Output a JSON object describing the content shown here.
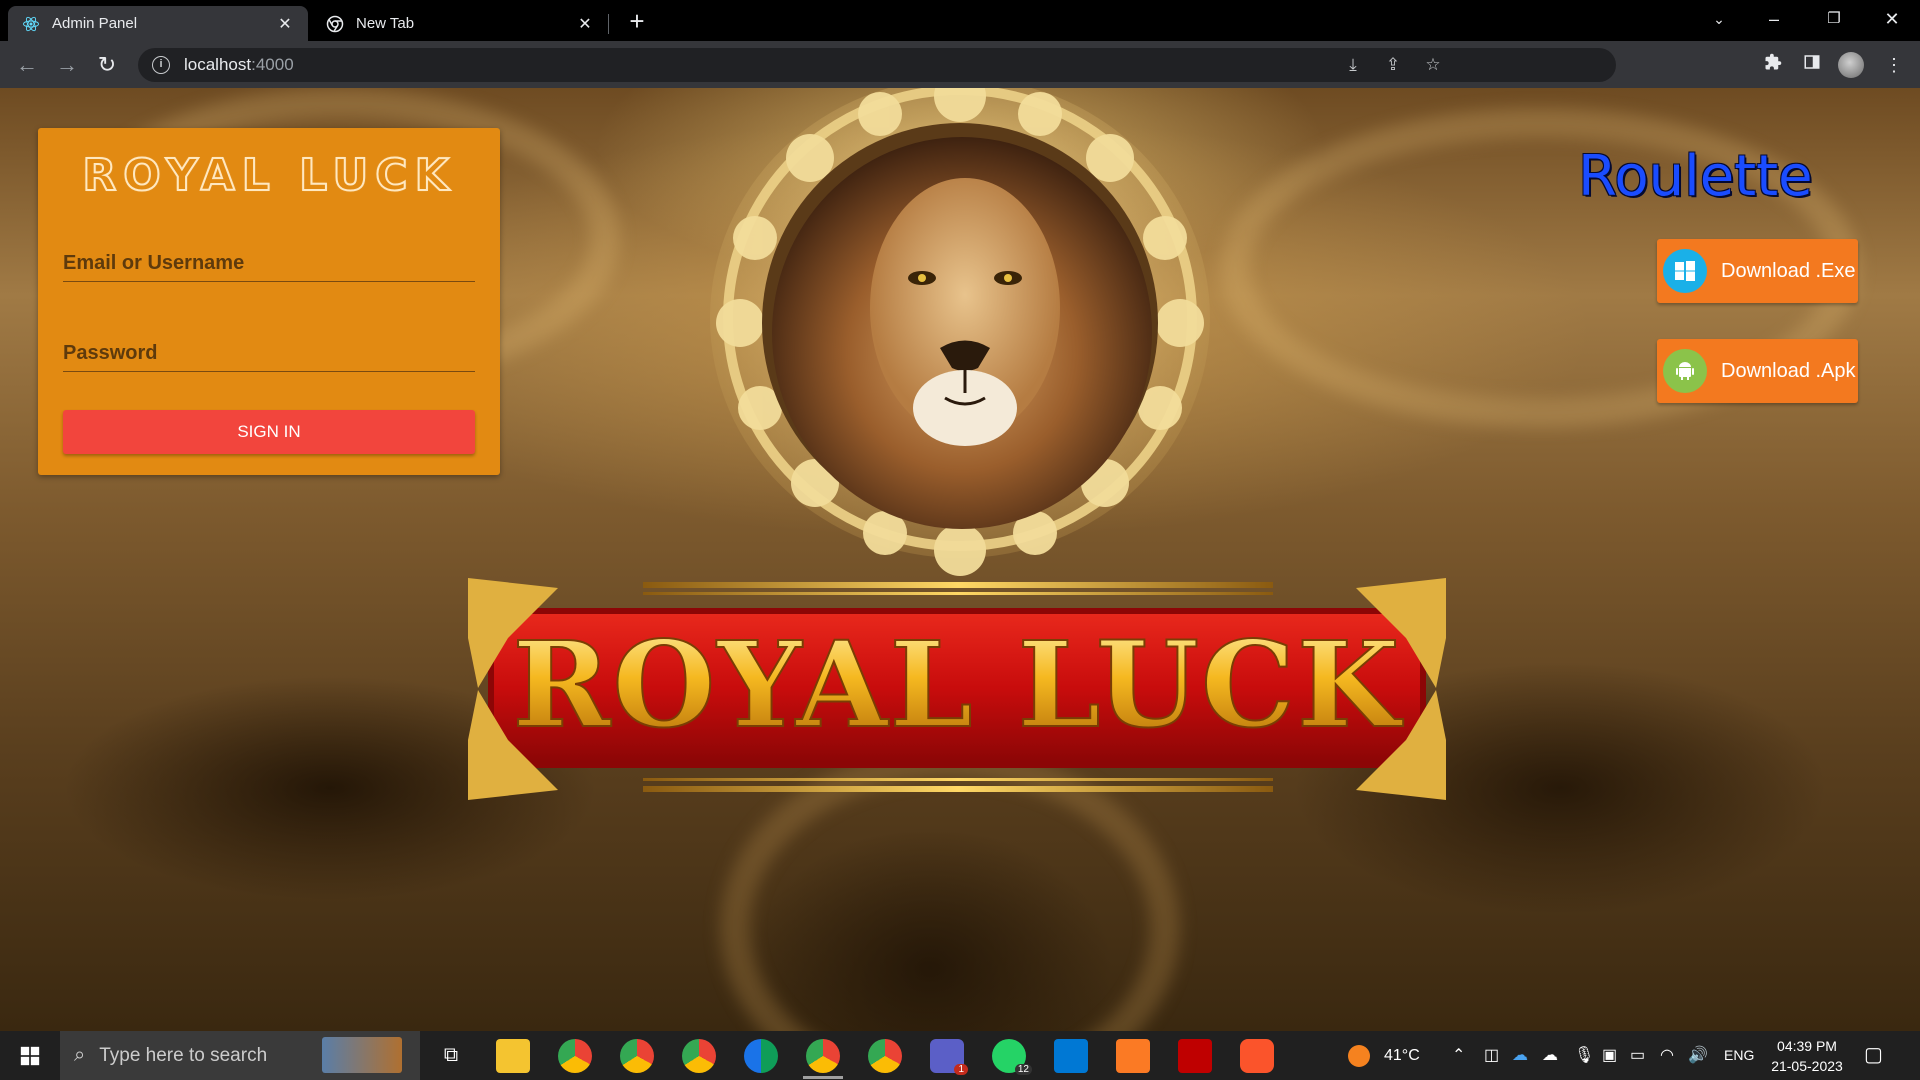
{
  "browser": {
    "tabs": [
      {
        "title": "Admin Panel",
        "favicon": "react-icon",
        "active": true
      },
      {
        "title": "New Tab",
        "favicon": "chrome-icon",
        "active": false
      }
    ],
    "address": {
      "host": "localhost",
      "port": ":4000"
    }
  },
  "login": {
    "brand": "ROYAL LUCK",
    "username_placeholder": "Email or Username",
    "password_placeholder": "Password",
    "signin_label": "SIGN IN"
  },
  "hero": {
    "banner_text": "ROYAL LUCK"
  },
  "side": {
    "title": "Roulette",
    "download_exe": "Download .Exe",
    "download_apk": "Download .Apk"
  },
  "taskbar": {
    "search_placeholder": "Type here to search",
    "weather": "41°C",
    "language": "ENG",
    "time": "04:39 PM",
    "date": "21-05-2023",
    "teams_badge": "1",
    "whatsapp_badge": "12"
  },
  "colors": {
    "login_card": "#e28a12",
    "signin_button": "#f2453d",
    "download_button": "#f3791f",
    "roulette_text": "#1a4cff"
  }
}
